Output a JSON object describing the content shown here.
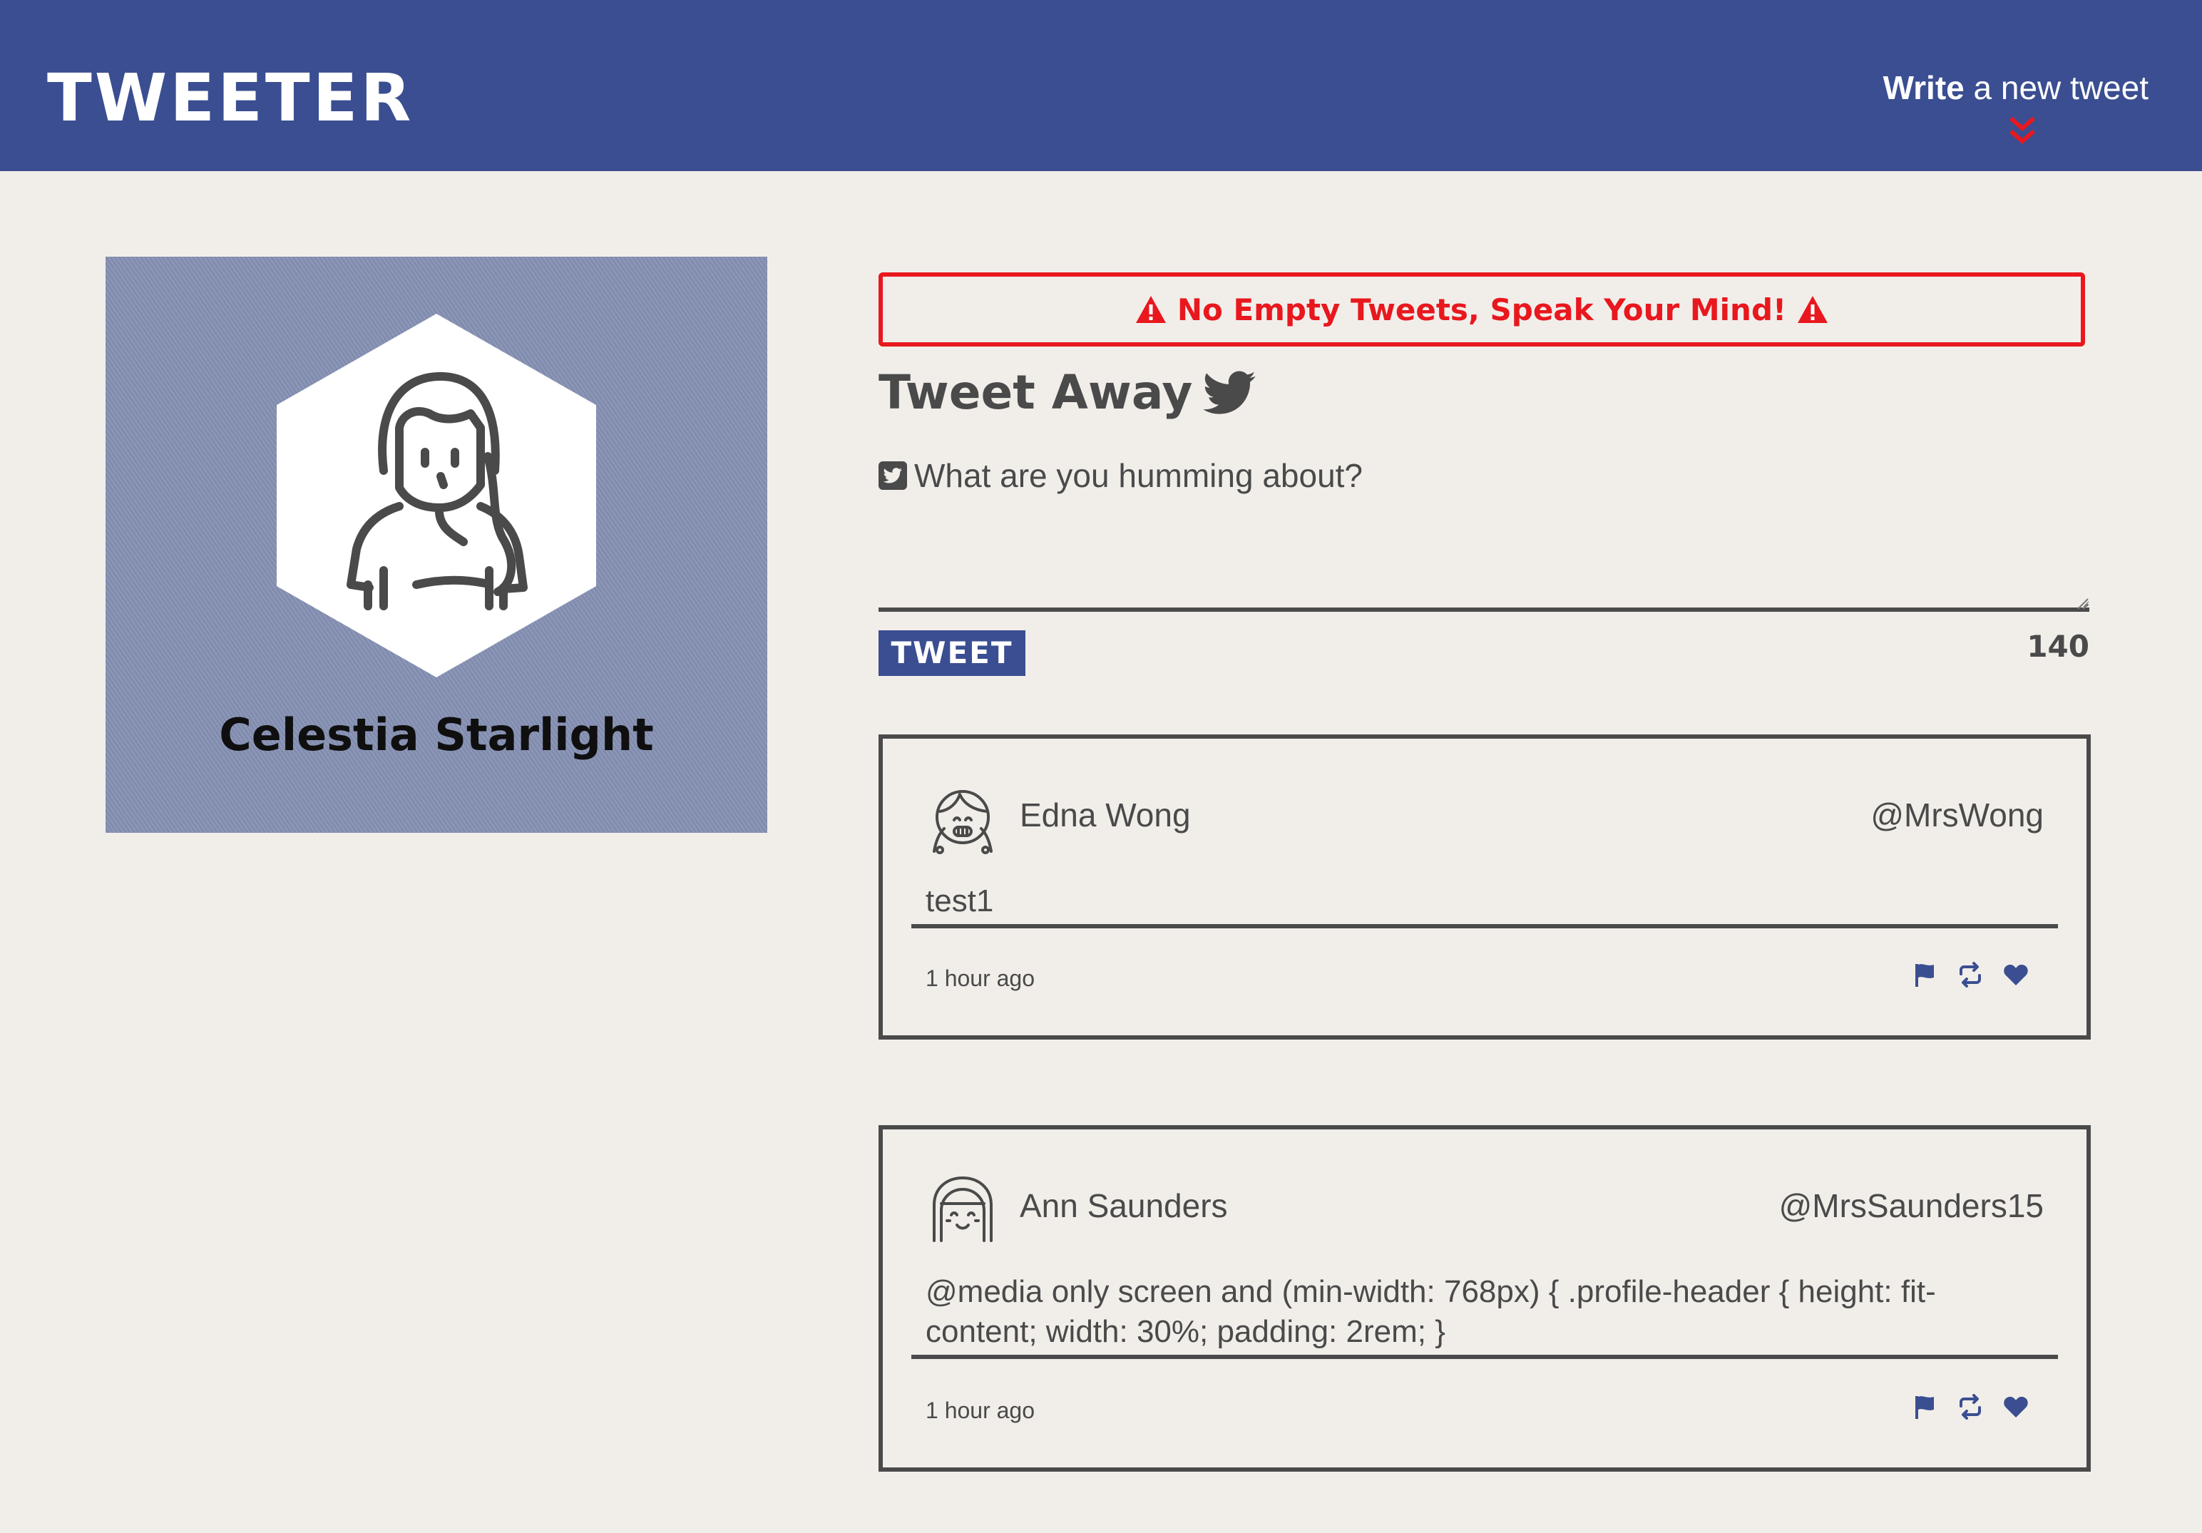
{
  "nav": {
    "logo": "TWEETER",
    "write_strong": "Write",
    "write_rest": " a new tweet",
    "icons": {
      "write_chevron": "double-chevron-down-icon"
    }
  },
  "profile": {
    "name": "Celestia Starlight",
    "avatar_icon": "woman-avatar-icon"
  },
  "compose": {
    "error": "No Empty Tweets, Speak Your Mind!",
    "title": "Tweet Away",
    "label": "What are you humming about?",
    "textarea_value": "",
    "button": "TWEET",
    "counter": "140"
  },
  "tweets": [
    {
      "name": "Edna Wong",
      "handle": "@MrsWong",
      "content": "test1",
      "time": "1 hour ago",
      "avatar_icon": "girl-avatar-icon"
    },
    {
      "name": "Ann Saunders",
      "handle": "@MrsSaunders15",
      "content": "@media only screen and (min-width: 768px) { .profile-header { height: fit-content; width: 30%; padding: 2rem; }",
      "time": "1 hour ago",
      "avatar_icon": "bob-hair-avatar-icon"
    }
  ],
  "colors": {
    "nav_bg": "#3a4e91",
    "page_bg": "#f1eeea",
    "error": "#e8181e",
    "text": "#4a4a4a",
    "accent": "#3a4e91"
  }
}
